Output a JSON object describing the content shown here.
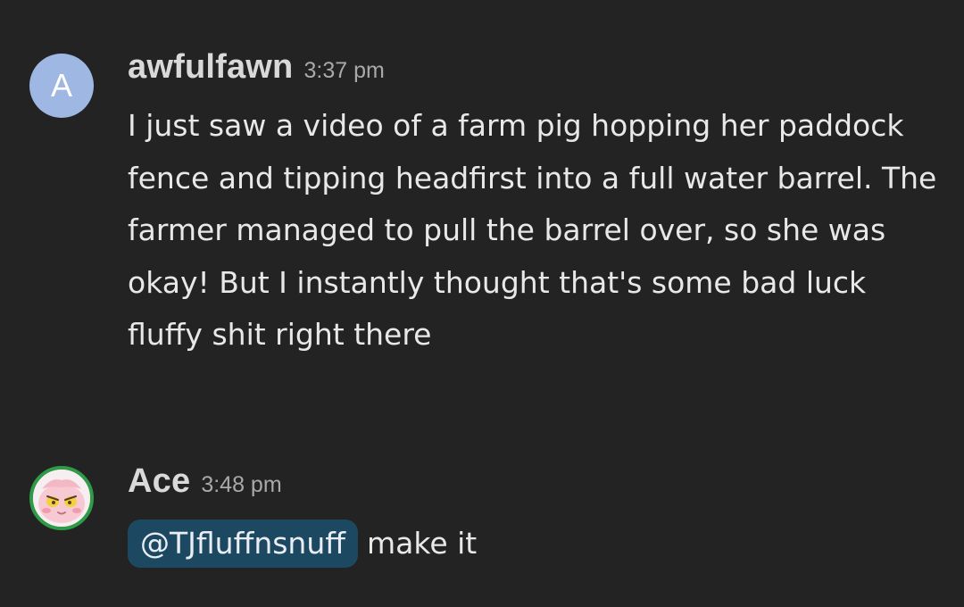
{
  "messages": [
    {
      "avatar_letter": "A",
      "avatar_color": "#9fb8e3",
      "username": "awfulfawn",
      "timestamp": "3:37 pm",
      "text": "I just saw a video of a farm pig hopping her paddock fence and tipping headfirst into a full water barrel. The farmer managed to pull the barrel over, so she was okay! But I instantly thought that's some bad luck fluffy shit right there"
    },
    {
      "avatar_icon": "pink-creature-avatar",
      "avatar_ring_color": "#2f9a48",
      "username": "Ace",
      "timestamp": "3:48 pm",
      "mention": "@TJfluffnsnuff",
      "mention_color": "#1c4861",
      "text": "make it"
    }
  ]
}
